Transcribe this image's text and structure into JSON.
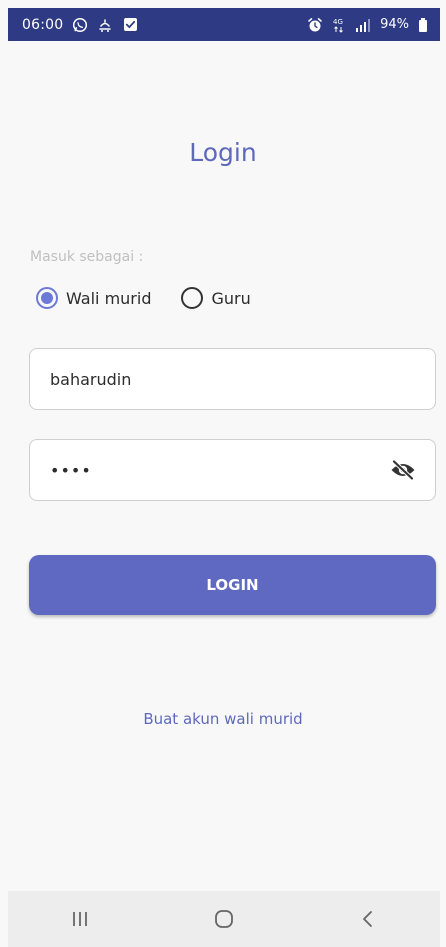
{
  "status_bar": {
    "time": "06:00",
    "battery": "94%",
    "network": "4G",
    "left_icons": [
      "whatsapp-icon",
      "notification-icon",
      "checkbox-icon"
    ],
    "right_icons": [
      "alarm-icon",
      "4g-icon",
      "signal-icon",
      "battery-icon"
    ],
    "background": "#2E3A84"
  },
  "page": {
    "title": "Login",
    "accent_color": "#5E69BD"
  },
  "role": {
    "label": "Masuk sebagai :",
    "options": [
      {
        "label": "Wali murid",
        "selected": true
      },
      {
        "label": "Guru",
        "selected": false
      }
    ]
  },
  "form": {
    "username_value": "baharudin",
    "password_value": "••••",
    "password_toggle_icon": "eye-off-icon"
  },
  "actions": {
    "login_label": "LOGIN",
    "login_color": "#5F69C2",
    "register_link": "Buat akun wali murid"
  },
  "nav": {
    "items": [
      "recent-apps-icon",
      "home-icon",
      "back-icon"
    ]
  }
}
